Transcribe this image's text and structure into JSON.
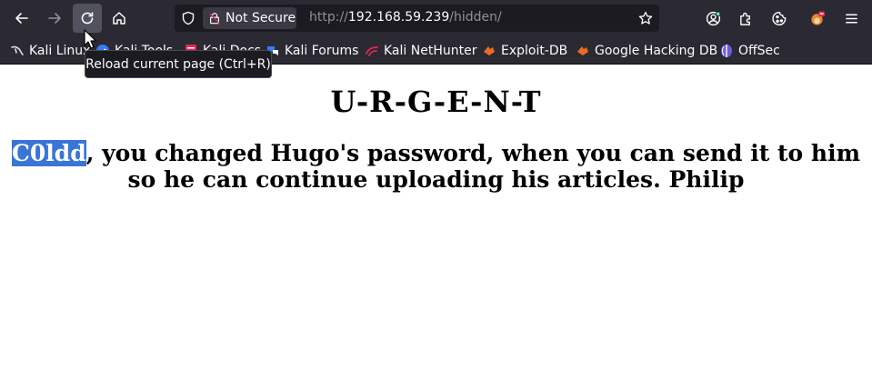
{
  "browser": {
    "url_scheme": "http://",
    "url_host": "192.168.59.239",
    "url_path": "/hidden/",
    "security_label": "Not Secure",
    "tooltip": "Reload current page (Ctrl+R)"
  },
  "bookmarks": [
    {
      "label": "Kali Linux",
      "icon": "kali-dragon-icon"
    },
    {
      "label": "Kali Tools",
      "icon": "kali-tools-icon"
    },
    {
      "label": "Kali Docs",
      "icon": "kali-docs-icon"
    },
    {
      "label": "Kali Forums",
      "icon": "kali-forums-icon"
    },
    {
      "label": "Kali NetHunter",
      "icon": "nethunter-icon"
    },
    {
      "label": "Exploit-DB",
      "icon": "exploit-db-icon"
    },
    {
      "label": "Google Hacking DB",
      "icon": "ghdb-icon"
    },
    {
      "label": "OffSec",
      "icon": "offsec-icon"
    }
  ],
  "page": {
    "heading": "U-R-G-E-N-T",
    "highlighted_word": "C0ldd",
    "message_rest": ", you changed Hugo's password, when you can send it to him so he can continue uploading his articles. Philip"
  },
  "colors": {
    "toolbar_bg": "#2b2a33",
    "urlbar_bg": "#1c1b22",
    "selection": "#3875d7"
  }
}
